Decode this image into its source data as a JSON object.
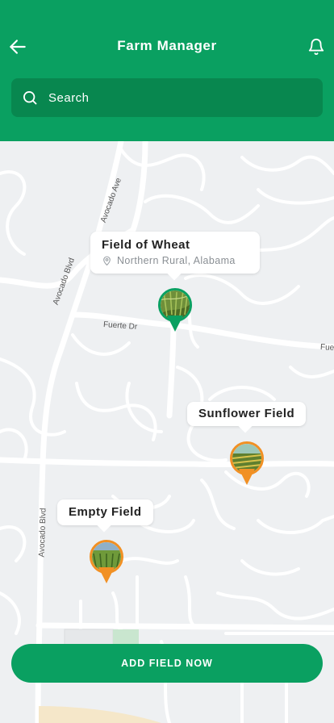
{
  "header": {
    "title": "Farm Manager",
    "back_icon": "arrow-left-icon",
    "notification_icon": "bell-icon",
    "search": {
      "placeholder": "Search",
      "value": "",
      "icon": "search-icon"
    }
  },
  "colors": {
    "primary": "#0aa061",
    "search_bg": "#08874f",
    "orange_marker": "#f19024"
  },
  "map": {
    "streets": [
      "Avocado Ave",
      "Avocado Blvd",
      "Fuerte Dr",
      "Fue",
      "Avocado Blvd"
    ],
    "fields": [
      {
        "name": "Field of Wheat",
        "location": "Northern Rural, Alabama",
        "location_icon": "map-pin-icon",
        "marker_color": "green"
      },
      {
        "name": "Sunflower Field",
        "marker_color": "orange"
      },
      {
        "name": "Empty Field",
        "marker_color": "orange"
      }
    ]
  },
  "actions": {
    "add_field_label": "ADD FIELD NOW"
  }
}
